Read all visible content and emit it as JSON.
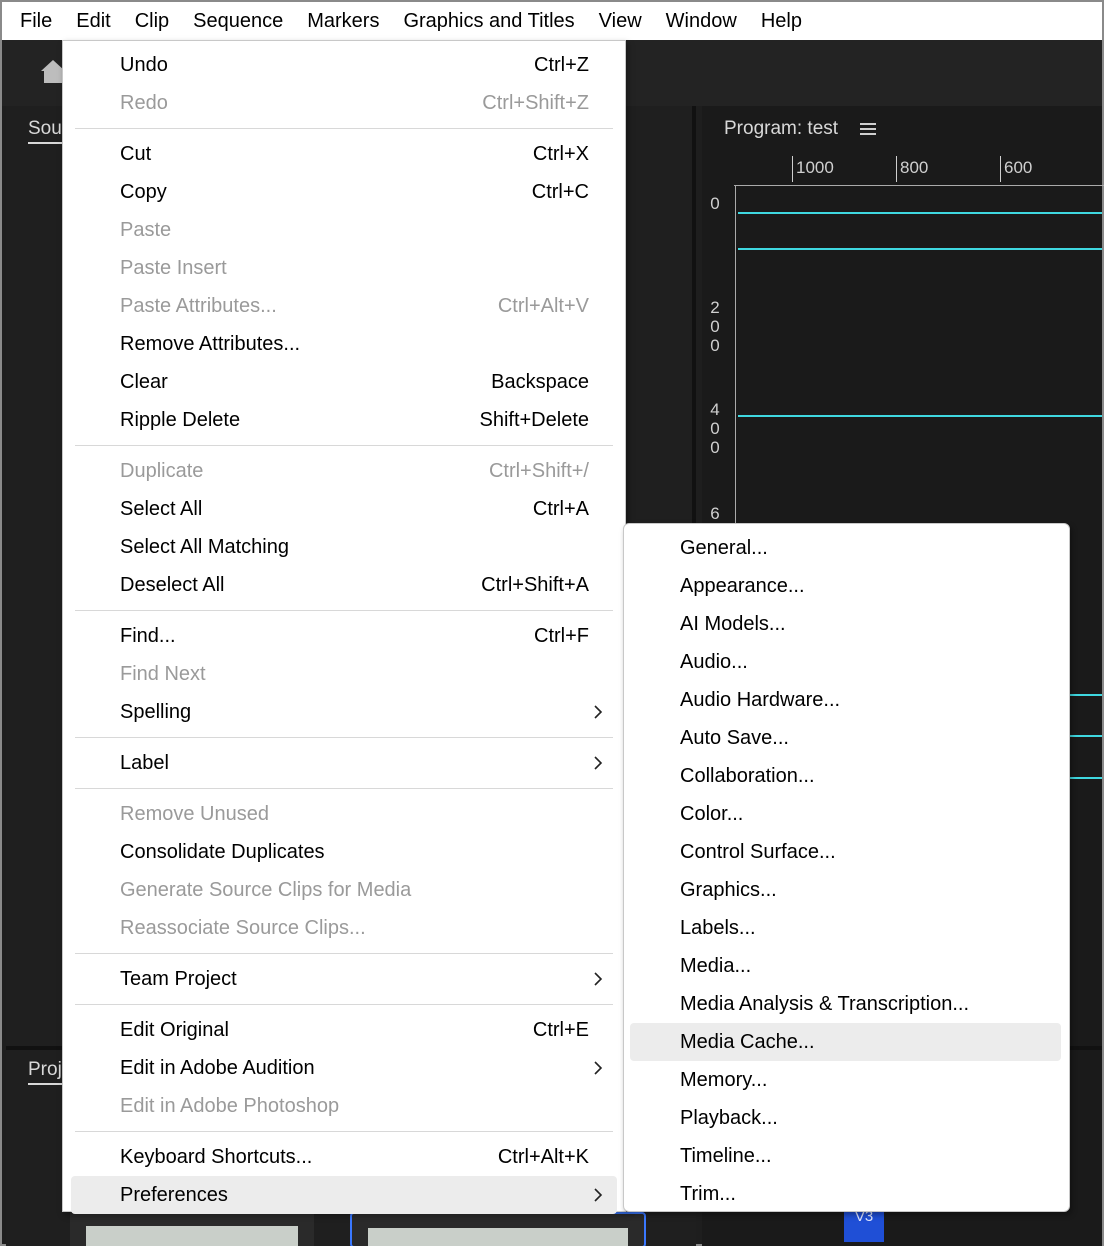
{
  "menubar": {
    "items": [
      "File",
      "Edit",
      "Clip",
      "Sequence",
      "Markers",
      "Graphics and Titles",
      "View",
      "Window",
      "Help"
    ],
    "active": "Edit"
  },
  "panels": {
    "source_tab": "Sou",
    "project_tab": "Proj",
    "program_title": "Program: test",
    "ruler_h_labels": [
      "1000",
      "800",
      "600"
    ],
    "ruler_v_labels": [
      "0",
      "200",
      "400",
      "6"
    ],
    "track_badge_selected": "V3",
    "track_badge": "V3"
  },
  "edit_menu": {
    "groups": [
      [
        {
          "label": "Undo",
          "shortcut": "Ctrl+Z",
          "enabled": true
        },
        {
          "label": "Redo",
          "shortcut": "Ctrl+Shift+Z",
          "enabled": false
        }
      ],
      [
        {
          "label": "Cut",
          "shortcut": "Ctrl+X",
          "enabled": true
        },
        {
          "label": "Copy",
          "shortcut": "Ctrl+C",
          "enabled": true
        },
        {
          "label": "Paste",
          "shortcut": "",
          "enabled": false
        },
        {
          "label": "Paste Insert",
          "shortcut": "",
          "enabled": false
        },
        {
          "label": "Paste Attributes...",
          "shortcut": "Ctrl+Alt+V",
          "enabled": false
        },
        {
          "label": "Remove Attributes...",
          "shortcut": "",
          "enabled": true
        },
        {
          "label": "Clear",
          "shortcut": "Backspace",
          "enabled": true
        },
        {
          "label": "Ripple Delete",
          "shortcut": "Shift+Delete",
          "enabled": true
        }
      ],
      [
        {
          "label": "Duplicate",
          "shortcut": "Ctrl+Shift+/",
          "enabled": false
        },
        {
          "label": "Select All",
          "shortcut": "Ctrl+A",
          "enabled": true
        },
        {
          "label": "Select All Matching",
          "shortcut": "",
          "enabled": true
        },
        {
          "label": "Deselect All",
          "shortcut": "Ctrl+Shift+A",
          "enabled": true
        }
      ],
      [
        {
          "label": "Find...",
          "shortcut": "Ctrl+F",
          "enabled": true
        },
        {
          "label": "Find Next",
          "shortcut": "",
          "enabled": false
        },
        {
          "label": "Spelling",
          "shortcut": "",
          "enabled": true,
          "submenu": true
        }
      ],
      [
        {
          "label": "Label",
          "shortcut": "",
          "enabled": true,
          "submenu": true
        }
      ],
      [
        {
          "label": "Remove Unused",
          "shortcut": "",
          "enabled": false
        },
        {
          "label": "Consolidate Duplicates",
          "shortcut": "",
          "enabled": true
        },
        {
          "label": "Generate Source Clips for Media",
          "shortcut": "",
          "enabled": false
        },
        {
          "label": "Reassociate Source Clips...",
          "shortcut": "",
          "enabled": false
        }
      ],
      [
        {
          "label": "Team Project",
          "shortcut": "",
          "enabled": true,
          "submenu": true
        }
      ],
      [
        {
          "label": "Edit Original",
          "shortcut": "Ctrl+E",
          "enabled": true
        },
        {
          "label": "Edit in Adobe Audition",
          "shortcut": "",
          "enabled": true,
          "submenu": true
        },
        {
          "label": "Edit in Adobe Photoshop",
          "shortcut": "",
          "enabled": false
        }
      ],
      [
        {
          "label": "Keyboard Shortcuts...",
          "shortcut": "Ctrl+Alt+K",
          "enabled": true
        },
        {
          "label": "Preferences",
          "shortcut": "",
          "enabled": true,
          "submenu": true,
          "highlighted": true
        }
      ]
    ]
  },
  "preferences_submenu": {
    "items": [
      "General...",
      "Appearance...",
      "AI Models...",
      "Audio...",
      "Audio Hardware...",
      "Auto Save...",
      "Collaboration...",
      "Color...",
      "Control Surface...",
      "Graphics...",
      "Labels...",
      "Media...",
      "Media Analysis & Transcription...",
      "Media Cache...",
      "Memory...",
      "Playback...",
      "Timeline...",
      "Trim..."
    ],
    "highlighted": "Media Cache..."
  },
  "colors": {
    "menu_bg": "#ffffff",
    "disabled_text": "#9a9a9a",
    "highlight": "#ececec",
    "app_bg": "#1e1e1e",
    "accent_cyan": "#3fd8e0",
    "selection_blue": "#1f4fd6"
  }
}
